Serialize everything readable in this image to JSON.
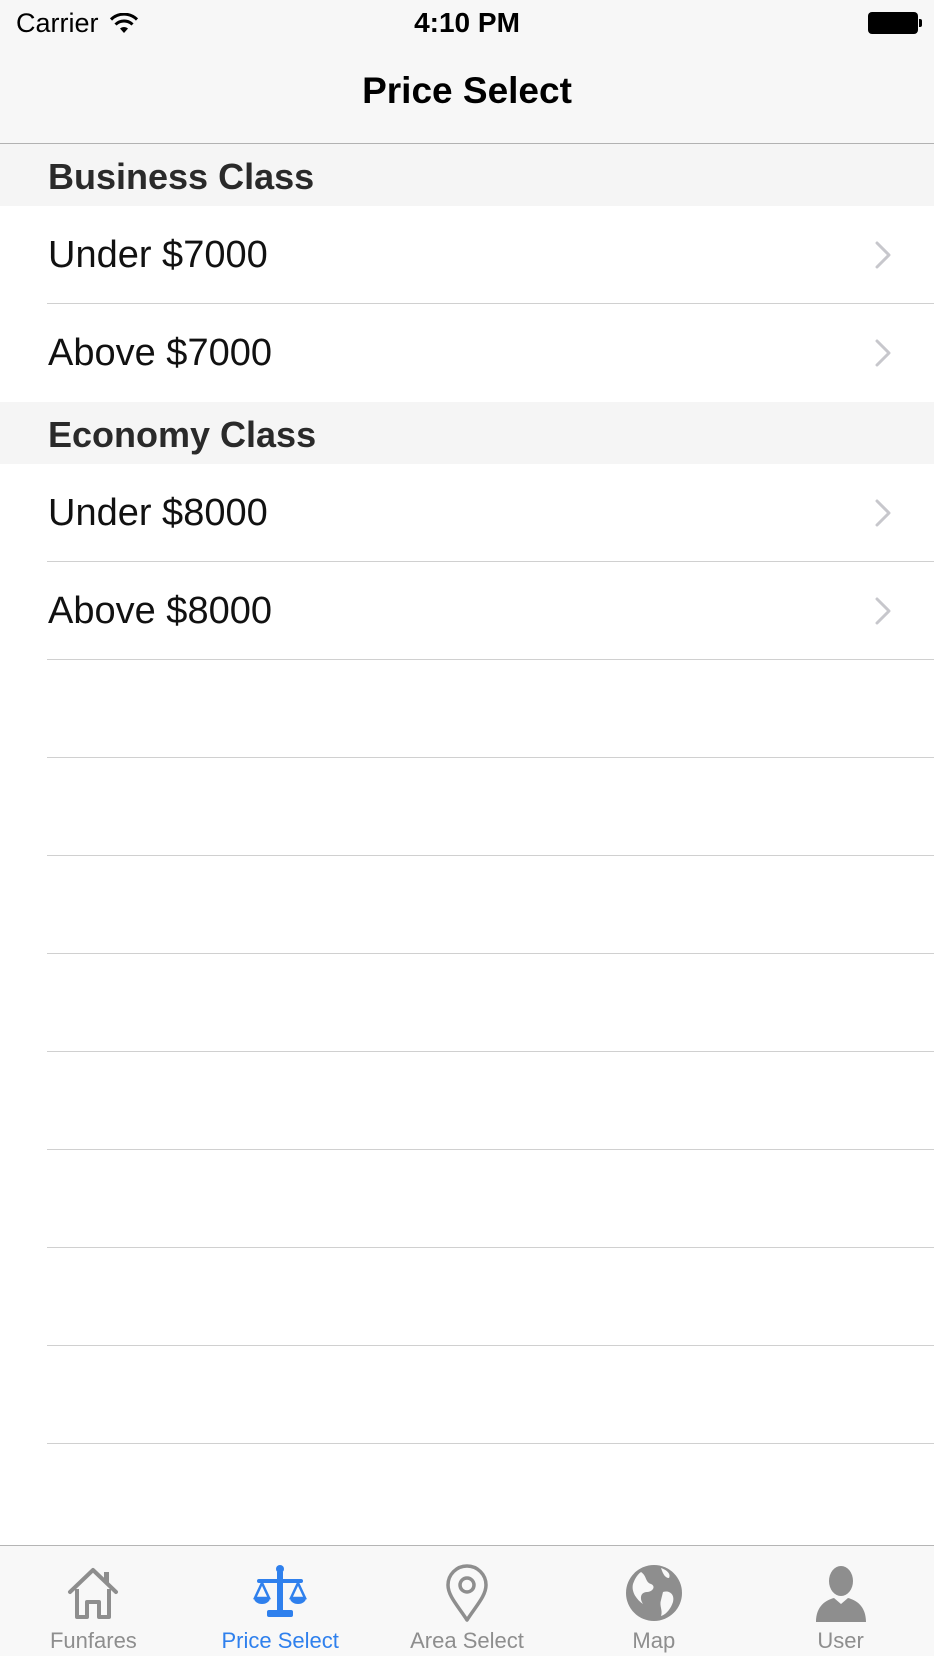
{
  "status_bar": {
    "carrier": "Carrier",
    "time": "4:10 PM"
  },
  "nav": {
    "title": "Price Select"
  },
  "sections": [
    {
      "header": "Business Class",
      "rows": [
        {
          "label": "Under $7000"
        },
        {
          "label": "Above $7000"
        }
      ]
    },
    {
      "header": "Economy Class",
      "rows": [
        {
          "label": "Under $8000"
        },
        {
          "label": "Above $8000"
        }
      ]
    }
  ],
  "tabs": [
    {
      "label": "Funfares",
      "icon": "home-icon",
      "active": false
    },
    {
      "label": "Price Select",
      "icon": "scales-icon",
      "active": true
    },
    {
      "label": "Area Select",
      "icon": "location-pin-icon",
      "active": false
    },
    {
      "label": "Map",
      "icon": "globe-icon",
      "active": false
    },
    {
      "label": "User",
      "icon": "user-icon",
      "active": false
    }
  ],
  "colors": {
    "active_tab": "#2f80ed",
    "inactive_tab": "#8e8e8e",
    "section_header_bg": "#f5f5f5",
    "chevron": "#c7c7cc"
  }
}
